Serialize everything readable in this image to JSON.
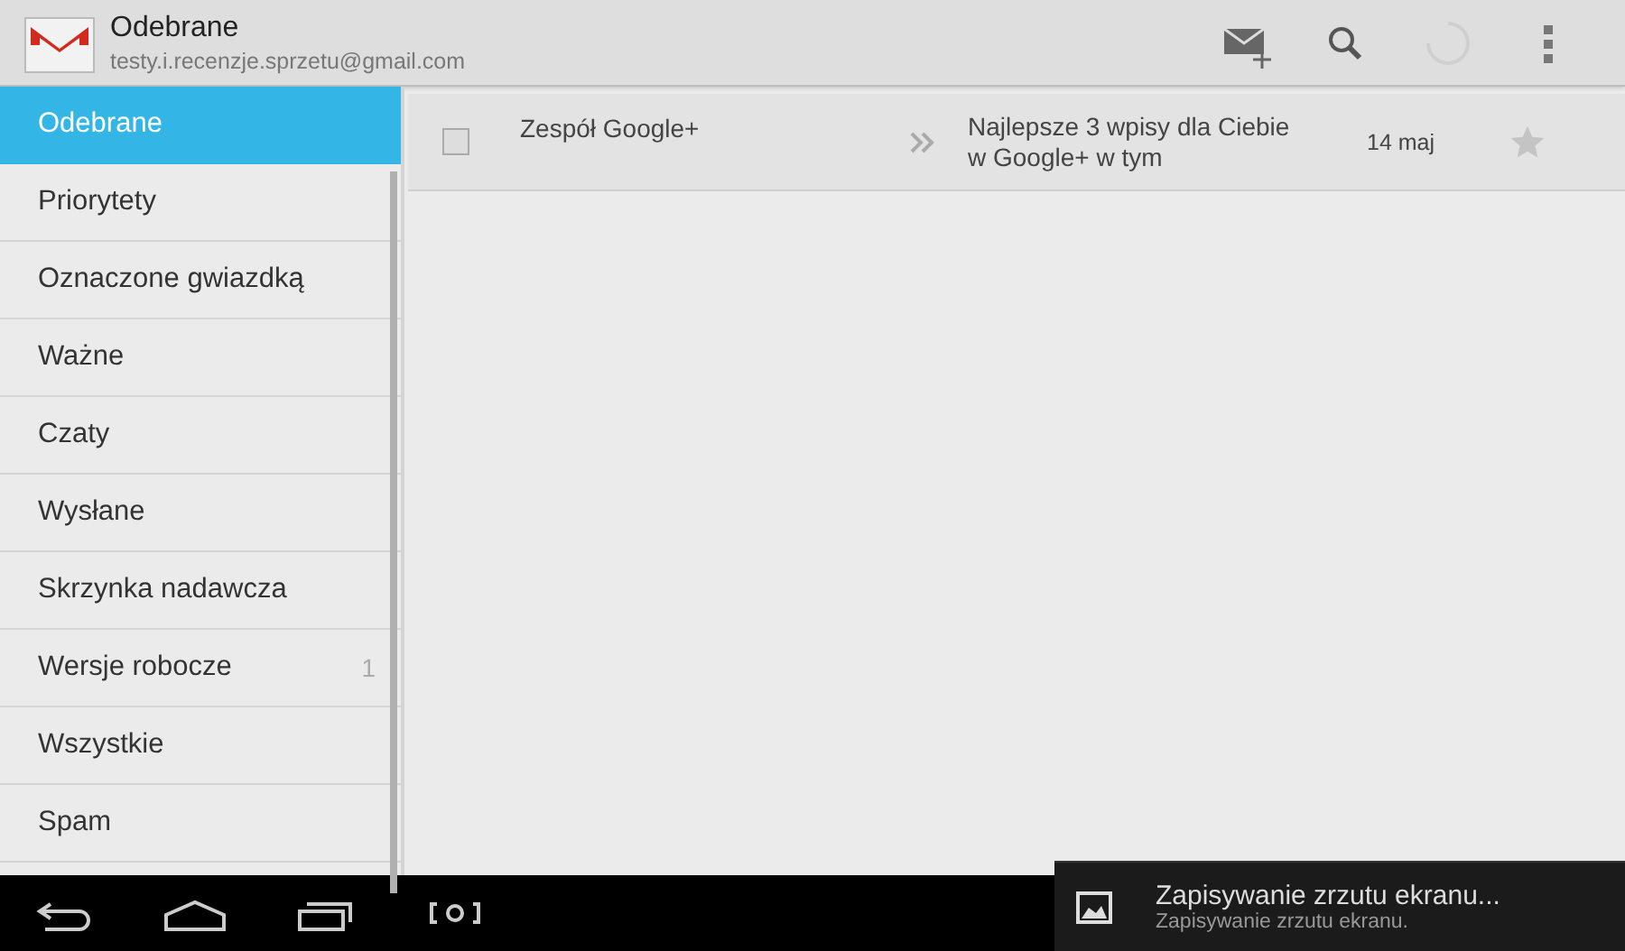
{
  "header": {
    "title": "Odebrane",
    "account": "testy.i.recenzje.sprzetu@gmail.com"
  },
  "sidebar": {
    "items": [
      {
        "label": "Odebrane",
        "selected": true
      },
      {
        "label": "Priorytety",
        "selected": false
      },
      {
        "label": "Oznaczone gwiazdką",
        "selected": false
      },
      {
        "label": "Ważne",
        "selected": false
      },
      {
        "label": "Czaty",
        "selected": false
      },
      {
        "label": "Wysłane",
        "selected": false
      },
      {
        "label": "Skrzynka nadawcza",
        "selected": false
      },
      {
        "label": "Wersje robocze",
        "count": "1",
        "selected": false
      },
      {
        "label": "Wszystkie",
        "selected": false
      },
      {
        "label": "Spam",
        "selected": false
      }
    ]
  },
  "messages": [
    {
      "sender": "Zespół Google+",
      "subject": "Najlepsze 3 wpisy dla Ciebie w Google+ w tym",
      "date": "14 maj",
      "checked": false,
      "starred": false
    }
  ],
  "notification": {
    "title": "Zapisywanie zrzutu ekranu...",
    "text": "Zapisywanie zrzutu ekranu."
  }
}
